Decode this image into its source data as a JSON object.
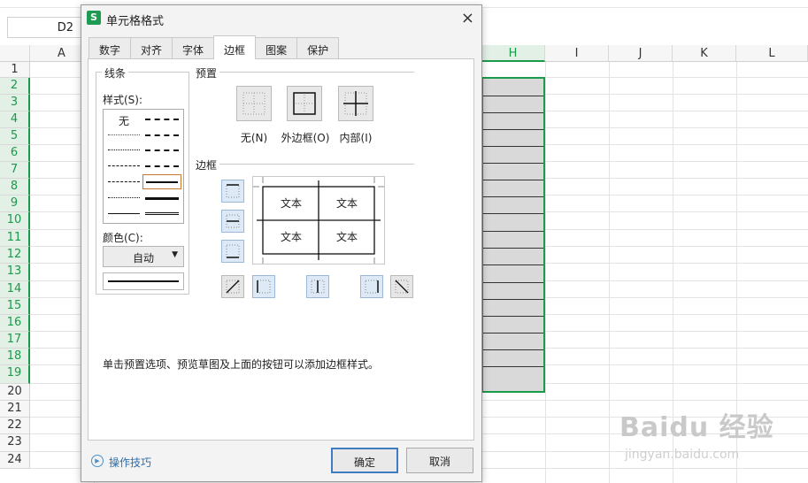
{
  "sheet": {
    "name_box": "D2",
    "columns_left": [
      "A"
    ],
    "columns_right": [
      "H",
      "I",
      "J",
      "K",
      "L"
    ],
    "rows": [
      "1",
      "2",
      "3",
      "4",
      "5",
      "6",
      "7",
      "8",
      "9",
      "10",
      "11",
      "12",
      "13",
      "14",
      "15",
      "16",
      "17",
      "18",
      "19",
      "20",
      "21",
      "22",
      "23",
      "24"
    ],
    "watermark": "Baidu 经验",
    "watermark_sub": "jingyan.baidu.com"
  },
  "dialog": {
    "title": "单元格格式",
    "app_icon": "S",
    "close_icon": "×",
    "tabs": [
      "数字",
      "对齐",
      "字体",
      "边框",
      "图案",
      "保护"
    ],
    "active_tab": "边框",
    "line_group": {
      "title": "线条",
      "style_label": "样式(S):",
      "none_label": "无",
      "color_label": "颜色(C):",
      "color_value": "自动",
      "dropdown_arrow": "▼"
    },
    "presets": {
      "title": "预置",
      "items": [
        {
          "label": "无(N)",
          "icon": "no-border-icon"
        },
        {
          "label": "外边框(O)",
          "icon": "outline-border-icon"
        },
        {
          "label": "内部(I)",
          "icon": "inside-border-icon"
        }
      ]
    },
    "border": {
      "title": "边框",
      "preview_text": "文本"
    },
    "hint": "单击预置选项、预览草图及上面的按钮可以添加边框样式。",
    "tips_label": "操作技巧",
    "ok_label": "确定",
    "cancel_label": "取消"
  },
  "colors": {
    "selection_green": "#1a9a4a",
    "accent_blue": "#3f7dc0",
    "arrow_red": "#e23c3c"
  }
}
